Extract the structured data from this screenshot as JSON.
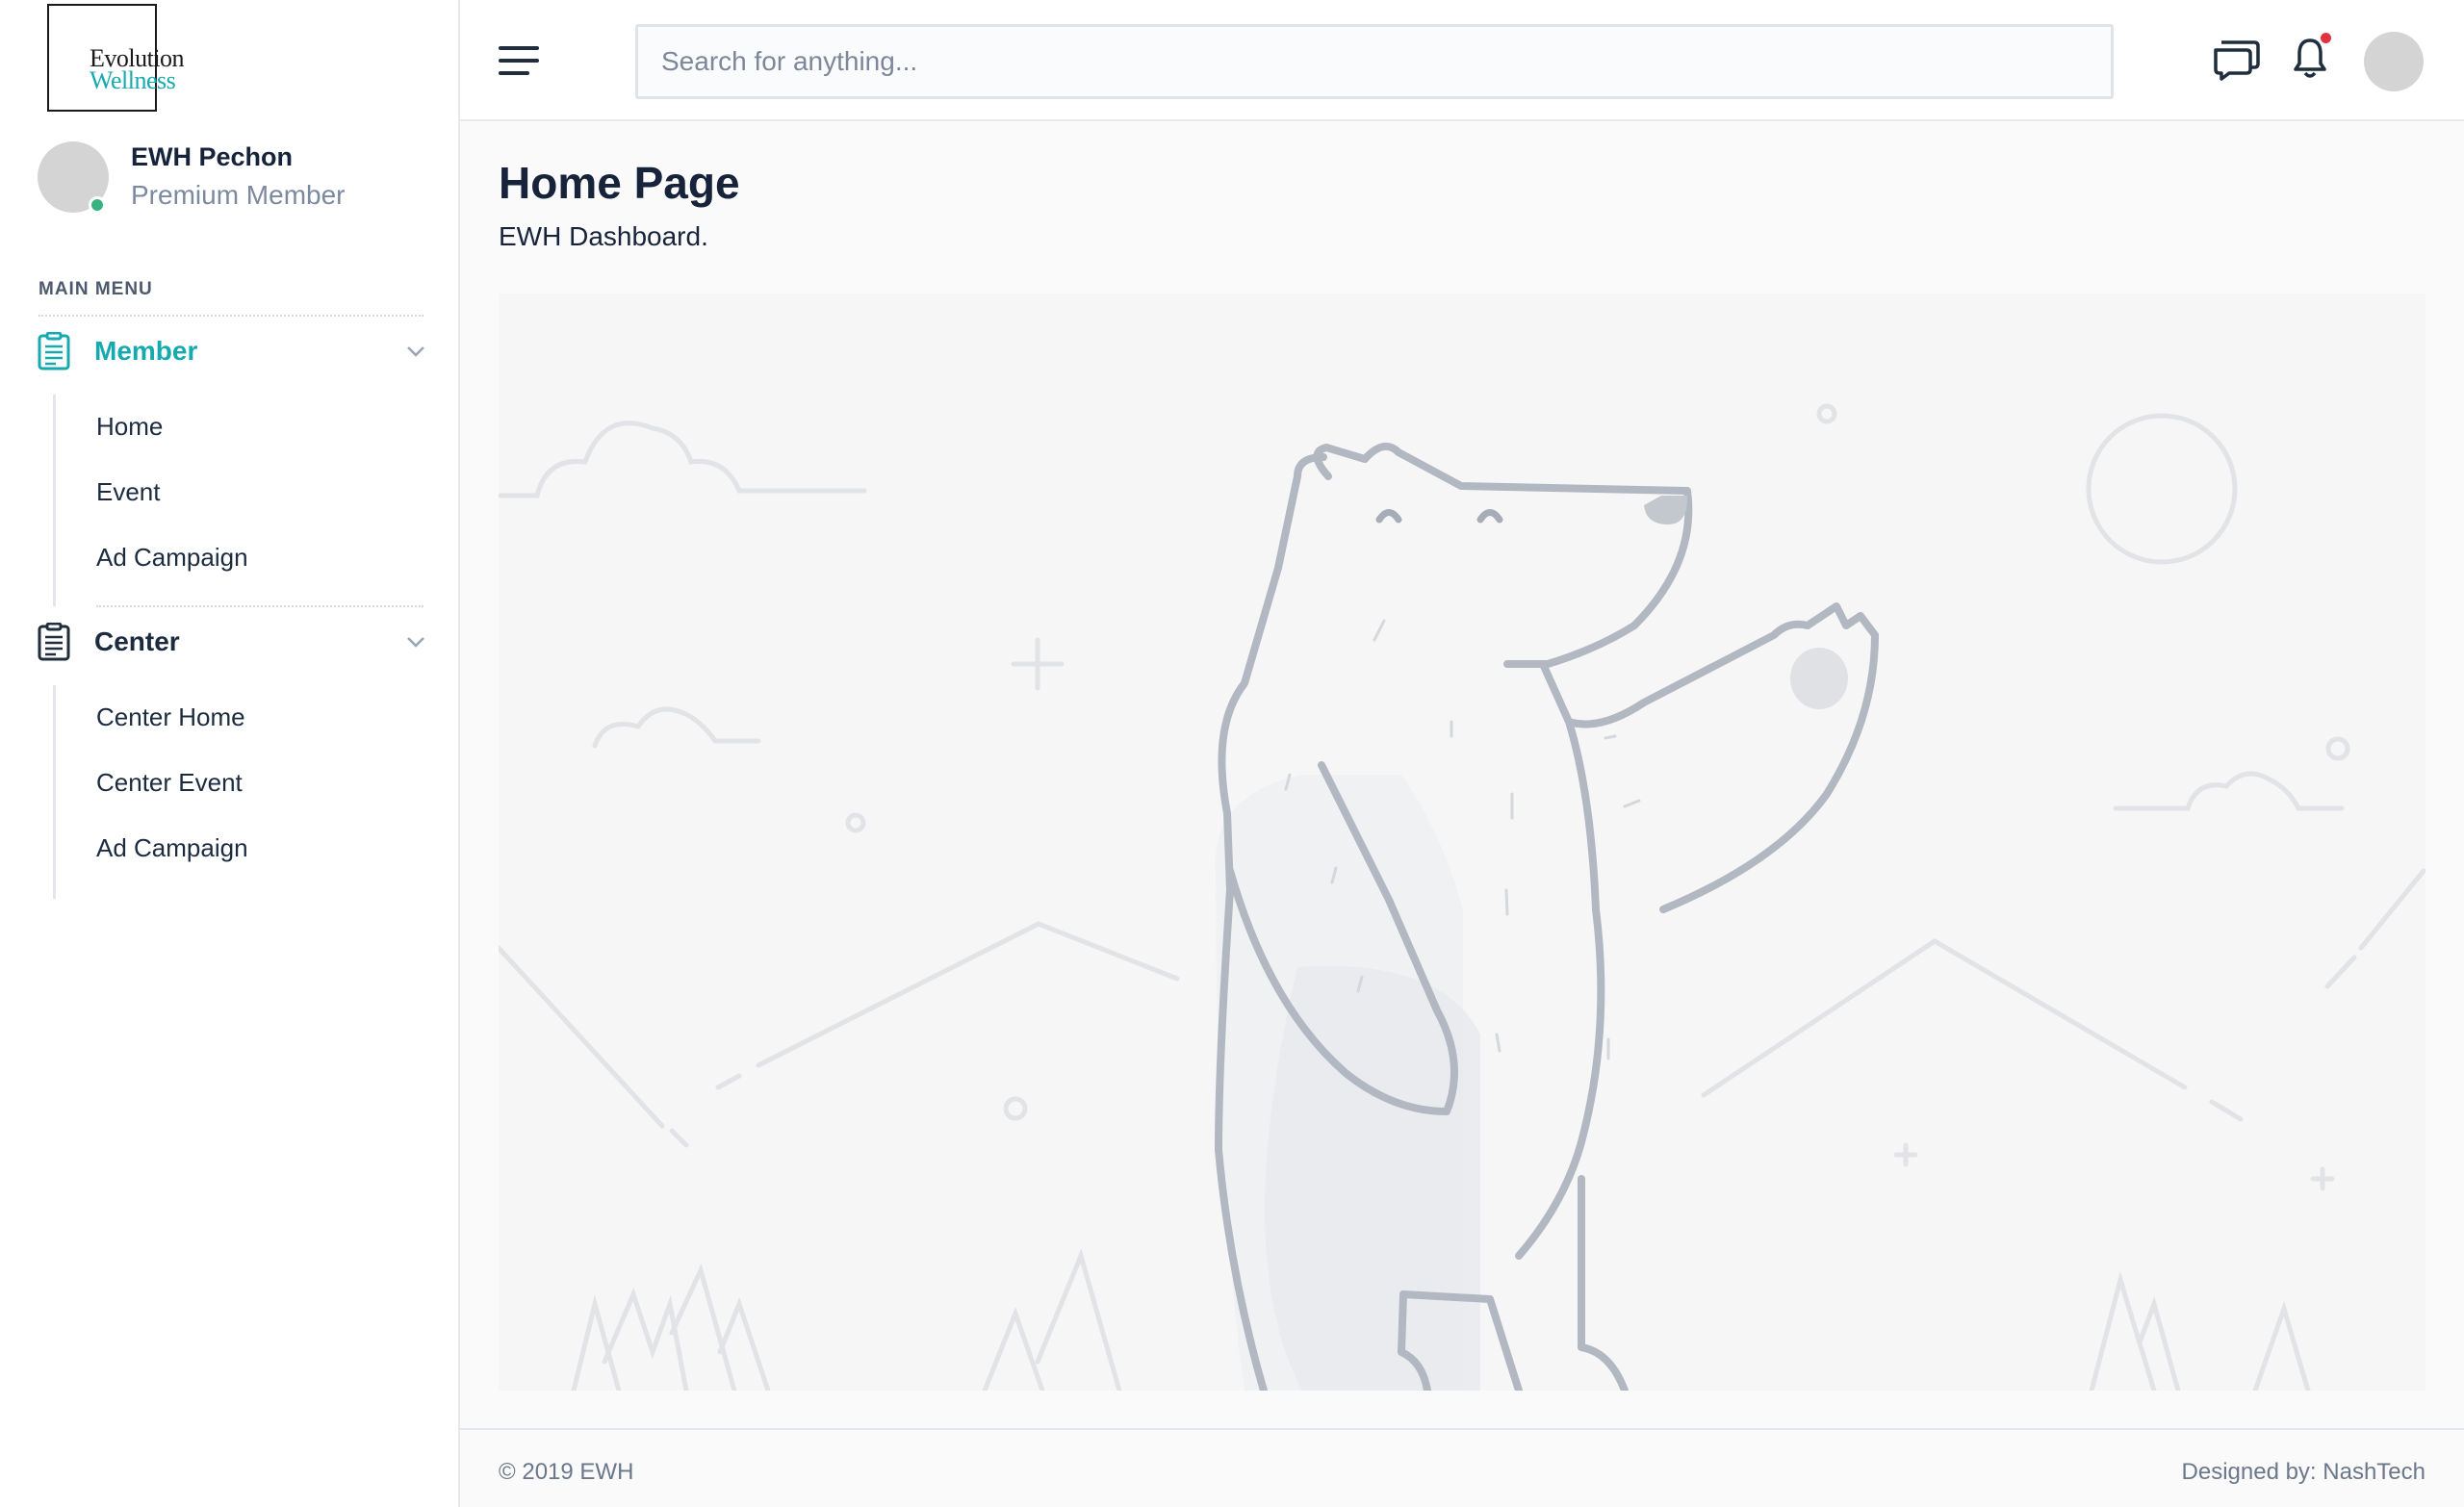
{
  "brand": {
    "logo_line1": "Evolution",
    "logo_line2": "Wellness",
    "accent_color": "#17a9b0"
  },
  "profile": {
    "name": "EWH Pechon",
    "role": "Premium Member",
    "status": "online"
  },
  "sidebar": {
    "heading": "MAIN MENU",
    "groups": [
      {
        "label": "Member",
        "icon": "clipboard-list-icon",
        "active": true,
        "items": [
          {
            "label": "Home"
          },
          {
            "label": "Event"
          },
          {
            "label": "Ad Campaign"
          }
        ]
      },
      {
        "label": "Center",
        "icon": "clipboard-list-icon",
        "active": false,
        "items": [
          {
            "label": "Center Home"
          },
          {
            "label": "Center Event"
          },
          {
            "label": "Ad Campaign"
          }
        ]
      }
    ]
  },
  "header": {
    "search_placeholder": "Search for anything...",
    "search_value": "",
    "icons": [
      "menu-icon",
      "chat-icon",
      "bell-icon",
      "user-avatar"
    ],
    "has_notification": true
  },
  "main": {
    "title": "Home Page",
    "subtitle": "EWH Dashboard.",
    "illustration": "polar-bear-illustration"
  },
  "footer": {
    "copyright": "© 2019 EWH",
    "designed_by": "Designed by: NashTech"
  }
}
